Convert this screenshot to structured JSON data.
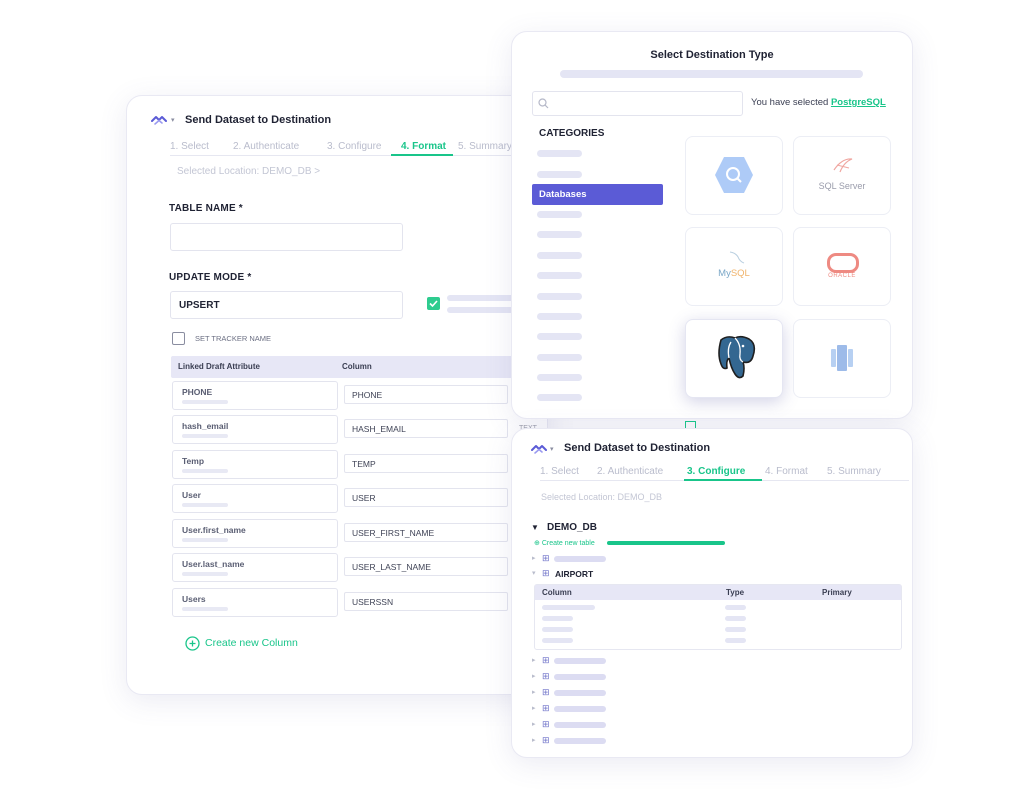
{
  "colors": {
    "accent": "#19c58a",
    "primary": "#5b5bd6",
    "postgres": "#336791",
    "oracle": "#e8746a",
    "mysql_text": "#7aa7c7"
  },
  "back_panel": {
    "title": "Send Dataset to Destination",
    "steps": [
      "1. Select",
      "2. Authenticate",
      "3. Configure",
      "4. Format",
      "5. Summary"
    ],
    "location": "Selected Location: DEMO_DB >",
    "table_name_label": "TABLE NAME *",
    "table_name_value": "",
    "update_mode_label": "UPDATE MODE *",
    "update_mode_value": "UPSERT",
    "tracker_label": "SET TRACKER NAME",
    "mapping_headers": [
      "Linked Draft Attribute",
      "Column"
    ],
    "mapping_rows": [
      {
        "attribute": "PHONE",
        "column": "PHONE"
      },
      {
        "attribute": "hash_email",
        "column": "HASH_EMAIL"
      },
      {
        "attribute": "Temp",
        "column": "TEMP"
      },
      {
        "attribute": "User",
        "column": "USER"
      },
      {
        "attribute": "User.first_name",
        "column": "USER_FIRST_NAME"
      },
      {
        "attribute": "User.last_name",
        "column": "USER_LAST_NAME"
      },
      {
        "attribute": "Users",
        "column": "USERSSN"
      }
    ],
    "create_column": "Create new Column"
  },
  "destination_panel": {
    "title": "Select Destination Type",
    "search_placeholder": "",
    "selected_prefix": "You have selected ",
    "selected_name": "PostgreSQL",
    "categories_label": "CATEGORIES",
    "active_category": "Databases",
    "peek_text": "TEXT",
    "tiles": [
      {
        "name": "bigquery",
        "icon": "bigquery-icon"
      },
      {
        "name": "sqlserver",
        "icon": "sqlserver-icon",
        "label": "SQL Server"
      },
      {
        "name": "mysql",
        "icon": "mysql-icon",
        "label_a": "My",
        "label_b": "SQL"
      },
      {
        "name": "oracle",
        "icon": "oracle-icon",
        "label": "ORACLE"
      },
      {
        "name": "postgresql",
        "icon": "postgresql-elephant-icon",
        "selected": true
      },
      {
        "name": "redshift",
        "icon": "redshift-icon"
      }
    ]
  },
  "configure_panel": {
    "title": "Send Dataset to Destination",
    "steps": [
      "1. Select",
      "2. Authenticate",
      "3. Configure",
      "4. Format",
      "5. Summary"
    ],
    "location": "Selected Location: DEMO_DB",
    "db_name": "DEMO_DB",
    "create_table": "Create new table",
    "table_name": "AIRPORT",
    "table_headers": [
      "Column",
      "Type",
      "Primary"
    ]
  }
}
